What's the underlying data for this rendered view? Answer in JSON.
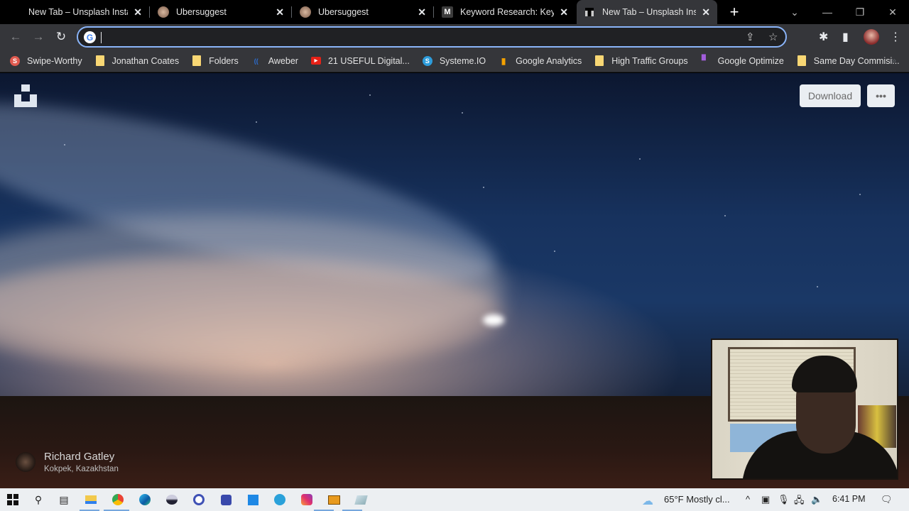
{
  "browser": {
    "tabs": [
      {
        "title": "New Tab – Unsplash Insta",
        "favicon": "unsplash-icon",
        "active": false
      },
      {
        "title": "Ubersuggest",
        "favicon": "ubersuggest-avatar-icon",
        "active": false
      },
      {
        "title": "Ubersuggest",
        "favicon": "ubersuggest-avatar-icon",
        "active": false
      },
      {
        "title": "Keyword Research: Keywo",
        "favicon": "m-logo-icon",
        "active": false
      },
      {
        "title": "New Tab – Unsplash Insta",
        "favicon": "unsplash-icon",
        "active": true
      }
    ],
    "tab_close_glyph": "✕",
    "new_tab_glyph": "+",
    "window_controls": {
      "tab_search": "⌄",
      "minimize": "—",
      "restore": "❐",
      "close": "✕"
    },
    "nav": {
      "back": "←",
      "forward": "→",
      "reload": "↻"
    },
    "omnibox": {
      "value": "",
      "placeholder": "",
      "engine_icon": "G"
    },
    "omnibox_actions": {
      "share": "⇪",
      "bookmark": "☆"
    },
    "toolbar_right": {
      "extensions": "✱",
      "side_panel": "▮",
      "menu": "⋮"
    },
    "bookmarks": [
      {
        "label": "Swipe-Worthy",
        "icon": "s-red-icon",
        "color": "#e05a4f",
        "glyph": "S"
      },
      {
        "label": "Jonathan Coates",
        "icon": "folder-icon"
      },
      {
        "label": "Folders",
        "icon": "folder-icon"
      },
      {
        "label": "Aweber",
        "icon": "aweber-icon",
        "color": "#2b6fd6",
        "glyph": "(("
      },
      {
        "label": "21 USEFUL Digital...",
        "icon": "youtube-icon",
        "color": "#e62117",
        "glyph": "▶"
      },
      {
        "label": "Systeme.IO",
        "icon": "systeme-icon",
        "color": "#2d9cdb",
        "glyph": "S"
      },
      {
        "label": "Google Analytics",
        "icon": "analytics-icon",
        "color": "#f4a100",
        "glyph": "▮"
      },
      {
        "label": "High Traffic Groups",
        "icon": "folder-icon"
      },
      {
        "label": "Google Optimize",
        "icon": "optimize-icon",
        "color": "#a25ddc",
        "glyph": "▘"
      },
      {
        "label": "Same Day Commisi...",
        "icon": "folder-icon"
      }
    ],
    "bookmarks_overflow": "»"
  },
  "page": {
    "download_label": "Download",
    "more_label": "•••",
    "photographer": "Richard Gatley",
    "location": "Kokpek, Kazakhstan"
  },
  "taskbar": {
    "apps": [
      "start-icon",
      "search-icon",
      "task-view-icon",
      "file-explorer-icon",
      "chrome-icon",
      "edge-icon",
      "app-orb-icon",
      "app-circle-icon",
      "app-square-icon",
      "store-icon",
      "telegram-icon",
      "instagram-icon",
      "monitor-app-icon",
      "notes-app-icon"
    ],
    "weather": "65°F  Mostly cl...",
    "time": "6:41 PM",
    "tray_glyphs": {
      "chevron": "^",
      "meet": "▣",
      "mic": "🎙",
      "network": "🖧",
      "volume": "🔈",
      "notifications": "🗨"
    }
  }
}
